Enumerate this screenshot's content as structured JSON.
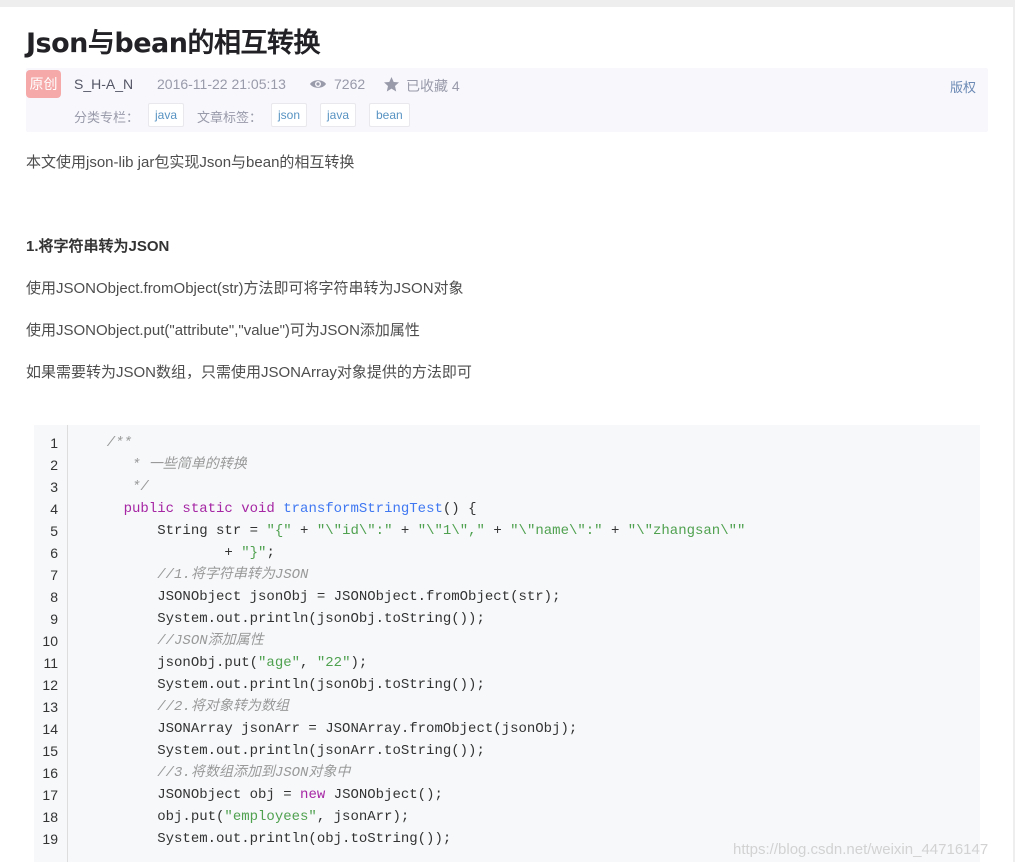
{
  "article": {
    "title": "Json与bean的相互转换",
    "meta": {
      "badge": "原创",
      "author": "S_H-A_N",
      "date": "2016-11-22 21:05:13",
      "views": "7262",
      "collected": "已收藏 4",
      "copyright": "版权",
      "category_label": "分类专栏：",
      "categories": [
        "java"
      ],
      "tags_label": "文章标签：",
      "tags": [
        "json",
        "java",
        "bean"
      ]
    },
    "intro": "本文使用json-lib jar包实现Json与bean的相互转换",
    "section1": {
      "heading": "1.将字符串转为JSON",
      "p1": "使用JSONObject.fromObject(str)方法即可将字符串转为JSON对象",
      "p2": "使用JSONObject.put(\"attribute\",\"value\")可为JSON添加属性",
      "p3": "如果需要转为JSON数组，只需使用JSONArray对象提供的方法即可"
    }
  },
  "code": {
    "lines": [
      {
        "num": "1",
        "tokens": [
          [
            "c",
            "  /**"
          ]
        ]
      },
      {
        "num": "2",
        "tokens": [
          [
            "c",
            "     * 一些简单的转换"
          ]
        ]
      },
      {
        "num": "3",
        "tokens": [
          [
            "c",
            "     */"
          ]
        ]
      },
      {
        "num": "4",
        "tokens": [
          [
            "p",
            "    "
          ],
          [
            "k",
            "public static void "
          ],
          [
            "f",
            "transformStringTest"
          ],
          [
            "p",
            "() {"
          ]
        ]
      },
      {
        "num": "5",
        "tokens": [
          [
            "p",
            "        String str = "
          ],
          [
            "s",
            "\"{\""
          ],
          [
            "p",
            " + "
          ],
          [
            "s",
            "\"\\\"id\\\":\""
          ],
          [
            "p",
            " + "
          ],
          [
            "s",
            "\"\\\"1\\\",\""
          ],
          [
            "p",
            " + "
          ],
          [
            "s",
            "\"\\\"name\\\":\""
          ],
          [
            "p",
            " + "
          ],
          [
            "s",
            "\"\\\"zhangsan\\\"\""
          ]
        ]
      },
      {
        "num": "6",
        "tokens": [
          [
            "p",
            "                + "
          ],
          [
            "s",
            "\"}\""
          ],
          [
            "p",
            ";"
          ]
        ]
      },
      {
        "num": "7",
        "tokens": [
          [
            "c",
            "        //1.将字符串转为JSON"
          ]
        ]
      },
      {
        "num": "8",
        "tokens": [
          [
            "p",
            "        JSONObject jsonObj = JSONObject.fromObject(str);"
          ]
        ]
      },
      {
        "num": "9",
        "tokens": [
          [
            "p",
            "        System.out.println(jsonObj.toString());"
          ]
        ]
      },
      {
        "num": "10",
        "tokens": [
          [
            "c",
            "        //JSON添加属性"
          ]
        ]
      },
      {
        "num": "11",
        "tokens": [
          [
            "p",
            "        jsonObj.put("
          ],
          [
            "s",
            "\"age\""
          ],
          [
            "p",
            ", "
          ],
          [
            "s",
            "\"22\""
          ],
          [
            "p",
            ");"
          ]
        ]
      },
      {
        "num": "12",
        "tokens": [
          [
            "p",
            "        System.out.println(jsonObj.toString());"
          ]
        ]
      },
      {
        "num": "13",
        "tokens": [
          [
            "c",
            "        //2.将对象转为数组"
          ]
        ]
      },
      {
        "num": "14",
        "tokens": [
          [
            "p",
            "        JSONArray jsonArr = JSONArray.fromObject(jsonObj);"
          ]
        ]
      },
      {
        "num": "15",
        "tokens": [
          [
            "p",
            "        System.out.println(jsonArr.toString());"
          ]
        ]
      },
      {
        "num": "16",
        "tokens": [
          [
            "c",
            "        //3.将数组添加到JSON对象中"
          ]
        ]
      },
      {
        "num": "17",
        "tokens": [
          [
            "p",
            "        JSONObject obj = "
          ],
          [
            "k",
            "new"
          ],
          [
            "p",
            " JSONObject();"
          ]
        ]
      },
      {
        "num": "18",
        "tokens": [
          [
            "p",
            "        obj.put("
          ],
          [
            "s",
            "\"employees\""
          ],
          [
            "p",
            ", jsonArr);"
          ]
        ]
      },
      {
        "num": "19",
        "tokens": [
          [
            "p",
            "        System.out.println(obj.toString());"
          ]
        ]
      }
    ]
  },
  "watermark": "https://blog.csdn.net/weixin_44716147"
}
